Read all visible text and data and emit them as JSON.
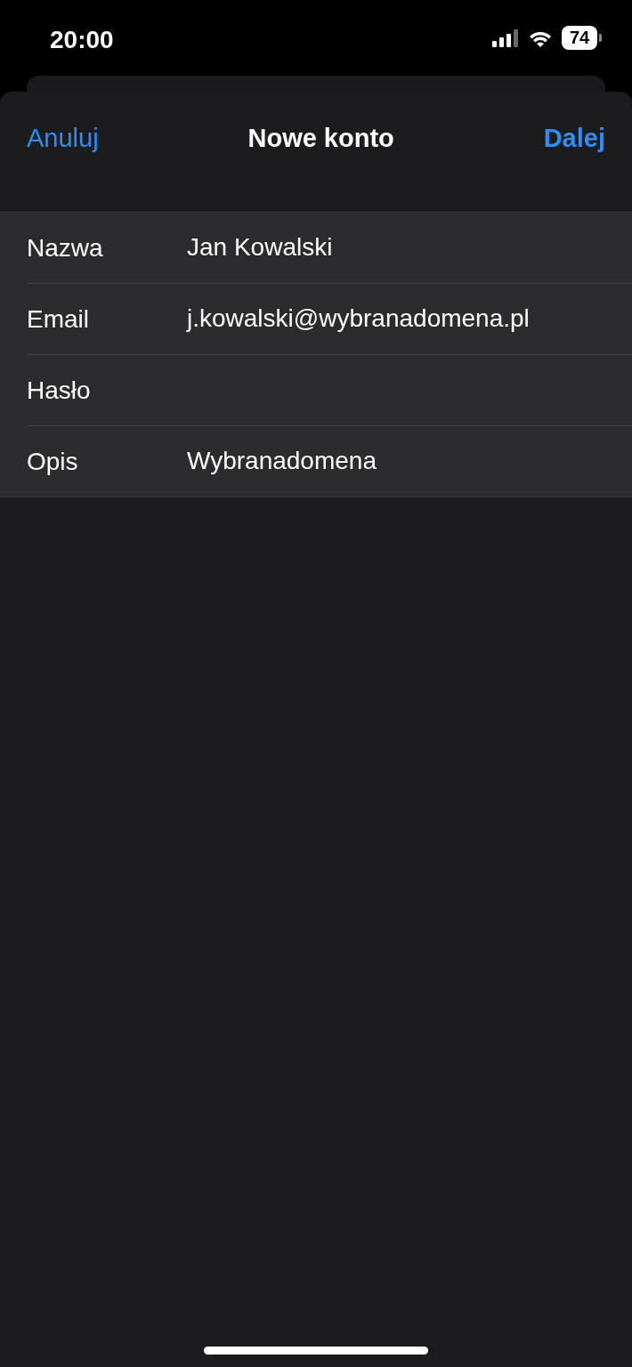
{
  "status_bar": {
    "time": "20:00",
    "battery": "74"
  },
  "nav": {
    "cancel": "Anuluj",
    "title": "Nowe konto",
    "next": "Dalej"
  },
  "form": {
    "rows": [
      {
        "label": "Nazwa",
        "value": "Jan Kowalski"
      },
      {
        "label": "Email",
        "value": "j.kowalski@wybranadomena.pl"
      },
      {
        "label": "Hasło"
      },
      {
        "label": "Opis",
        "value": "Wybranadomena"
      }
    ]
  }
}
